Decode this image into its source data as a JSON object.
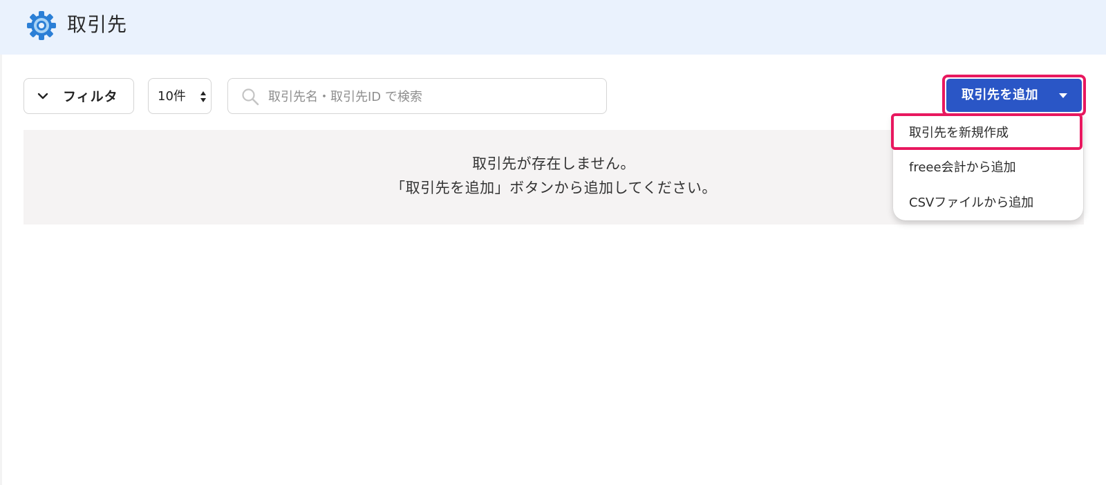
{
  "header": {
    "title": "取引先",
    "icon": "gear-icon"
  },
  "toolbar": {
    "filter_label": "フィルタ",
    "per_page_value": "10件",
    "search_placeholder": "取引先名・取引先ID で検索",
    "add_button_label": "取引先を追加"
  },
  "empty_state": {
    "line1": "取引先が存在しません。",
    "line2": "「取引先を追加」ボタンから追加してください。"
  },
  "add_menu": {
    "items": [
      {
        "label": "取引先を新規作成"
      },
      {
        "label": "freee会計から追加"
      },
      {
        "label": "CSVファイルから追加"
      }
    ]
  },
  "colors": {
    "header_bg": "#eaf2fd",
    "primary": "#2a56c6",
    "highlight": "#e8185f",
    "empty_bg": "#f5f3f3",
    "gear": "#2b7fd6"
  }
}
